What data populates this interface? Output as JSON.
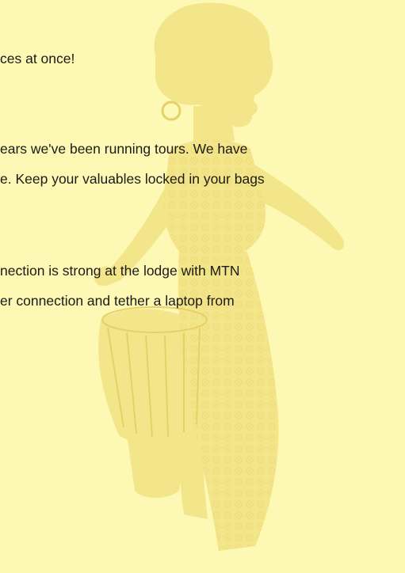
{
  "paragraphs": [
    {
      "lines": [
        "ces at once!"
      ]
    },
    {
      "lines": [
        "ears we've been running tours. We have",
        "e. Keep your valuables locked in your bags"
      ]
    },
    {
      "lines": [
        "nection is strong at the lodge with MTN",
        "er connection and tether a laptop from"
      ]
    }
  ],
  "colors": {
    "background": "#fdf8b4",
    "watermark": "#f3e58a",
    "text": "#1c1b16"
  },
  "icons": {
    "watermark": "drummer-woman-silhouette-icon"
  }
}
